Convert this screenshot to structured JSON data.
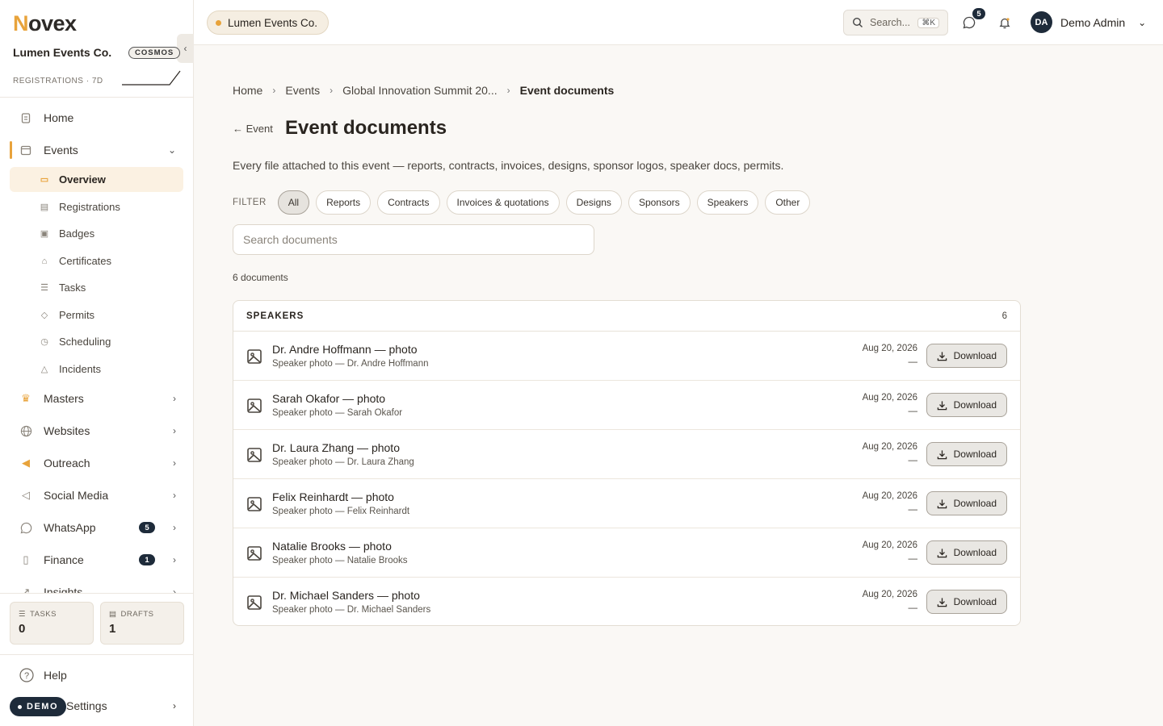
{
  "brand": {
    "logo_initial": "N",
    "logo_rest": "ovex"
  },
  "sidebar": {
    "org_name": "Lumen Events Co.",
    "plan": "COSMOS",
    "registrations_label": "REGISTRATIONS · 7D",
    "nav": [
      {
        "label": "Home",
        "icon": "clipboard-icon"
      },
      {
        "label": "Events",
        "icon": "calendar-icon",
        "expanded": true
      },
      {
        "label": "Masters",
        "icon": "trophy-icon"
      },
      {
        "label": "Websites",
        "icon": "globe-icon"
      },
      {
        "label": "Outreach",
        "icon": "megaphone-icon"
      },
      {
        "label": "Social Media",
        "icon": "megaphone-outline-icon"
      },
      {
        "label": "WhatsApp",
        "icon": "whatsapp-icon",
        "count": "5"
      },
      {
        "label": "Finance",
        "icon": "receipt-icon",
        "count": "1"
      },
      {
        "label": "Insights",
        "icon": "chart-icon"
      }
    ],
    "events_sub": [
      {
        "label": "Overview",
        "icon": "calendar-icon",
        "active": true
      },
      {
        "label": "Registrations",
        "icon": "clipboard-icon"
      },
      {
        "label": "Badges",
        "icon": "id-card-icon"
      },
      {
        "label": "Certificates",
        "icon": "graduation-cap-icon"
      },
      {
        "label": "Tasks",
        "icon": "checklist-icon"
      },
      {
        "label": "Permits",
        "icon": "shield-icon"
      },
      {
        "label": "Scheduling",
        "icon": "calendar-clock-icon"
      },
      {
        "label": "Incidents",
        "icon": "warning-icon"
      }
    ],
    "stats": [
      {
        "label": "TASKS",
        "value": "0"
      },
      {
        "label": "DRAFTS",
        "value": "1"
      }
    ],
    "help_label": "Help",
    "settings_label": "Settings",
    "demo_label": "DEMO"
  },
  "topbar": {
    "org_chip": "Lumen Events Co.",
    "search_label": "Search...",
    "search_shortcut": "⌘K",
    "whatsapp_badge": "5",
    "user_initials": "DA",
    "user_name": "Demo Admin"
  },
  "breadcrumb": [
    "Home",
    "Events",
    "Global Innovation Summit 20...",
    "Event documents"
  ],
  "page": {
    "back_label": "← Event",
    "title": "Event documents",
    "description": "Every file attached to this event — reports, contracts, invoices, designs, sponsor logos, speaker docs, permits.",
    "filter_label": "FILTER",
    "filters": [
      "All",
      "Reports",
      "Contracts",
      "Invoices & quotations",
      "Designs",
      "Sponsors",
      "Speakers",
      "Other"
    ],
    "active_filter": "All",
    "search_placeholder": "Search documents",
    "doc_count": "6 documents"
  },
  "documents": {
    "group": "SPEAKERS",
    "group_count": "6",
    "download_label": "Download",
    "rows": [
      {
        "title": "Dr. Andre Hoffmann — photo",
        "subtitle": "Speaker photo — Dr. Andre Hoffmann",
        "date": "Aug 20, 2026",
        "size": "—"
      },
      {
        "title": "Sarah Okafor — photo",
        "subtitle": "Speaker photo — Sarah Okafor",
        "date": "Aug 20, 2026",
        "size": "—"
      },
      {
        "title": "Dr. Laura Zhang — photo",
        "subtitle": "Speaker photo — Dr. Laura Zhang",
        "date": "Aug 20, 2026",
        "size": "—"
      },
      {
        "title": "Felix Reinhardt — photo",
        "subtitle": "Speaker photo — Felix Reinhardt",
        "date": "Aug 20, 2026",
        "size": "—"
      },
      {
        "title": "Natalie Brooks — photo",
        "subtitle": "Speaker photo — Natalie Brooks",
        "date": "Aug 20, 2026",
        "size": "—"
      },
      {
        "title": "Dr. Michael Sanders — photo",
        "subtitle": "Speaker photo — Dr. Michael Sanders",
        "date": "Aug 20, 2026",
        "size": "—"
      }
    ]
  },
  "colors": {
    "accent": "#e8a33b",
    "navy": "#1e2b3a",
    "background": "#faf8f5"
  }
}
